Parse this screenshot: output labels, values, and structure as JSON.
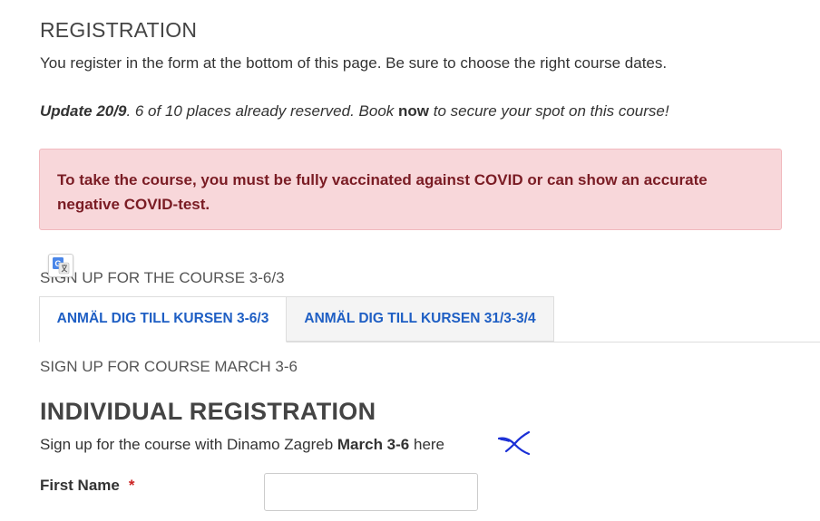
{
  "header": {
    "title": "REGISTRATION",
    "intro": "You register in the form at the bottom of this page. Be sure to choose the right course dates."
  },
  "update": {
    "lead": "Update 20/9",
    "text_before": ". 6 of 10 places already reserved. Book ",
    "emphasis": "now",
    "text_after": " to secure your spot on this course!"
  },
  "alert": {
    "text": "To take the course, you must be fully vaccinated against COVID or can show an accurate negative COVID-test."
  },
  "signup_heading": "SIGN UP FOR THE COURSE 3-6/3",
  "tabs": [
    {
      "label": "ANMÄL DIG TILL KURSEN 3-6/3",
      "active": true
    },
    {
      "label": "ANMÄL DIG TILL KURSEN 31/3-3/4",
      "active": false
    }
  ],
  "course_heading": "SIGN UP FOR COURSE MARCH 3-6",
  "form": {
    "title": "INDIVIDUAL REGISTRATION",
    "desc_before": "Sign up for the course with Dinamo Zagreb ",
    "desc_bold": "March 3-6",
    "desc_after": " here",
    "fields": [
      {
        "label": "First Name",
        "required_mark": "*",
        "value": "",
        "placeholder": ""
      }
    ]
  },
  "icons": {
    "translate": "google-translate-icon",
    "scribble": "handwritten-x-mark"
  },
  "colors": {
    "alert_bg": "#f8d7da",
    "alert_text": "#7a1c24",
    "tab_link": "#1f5fc4",
    "required": "#cc2222",
    "scribble": "#1a2fd6"
  }
}
